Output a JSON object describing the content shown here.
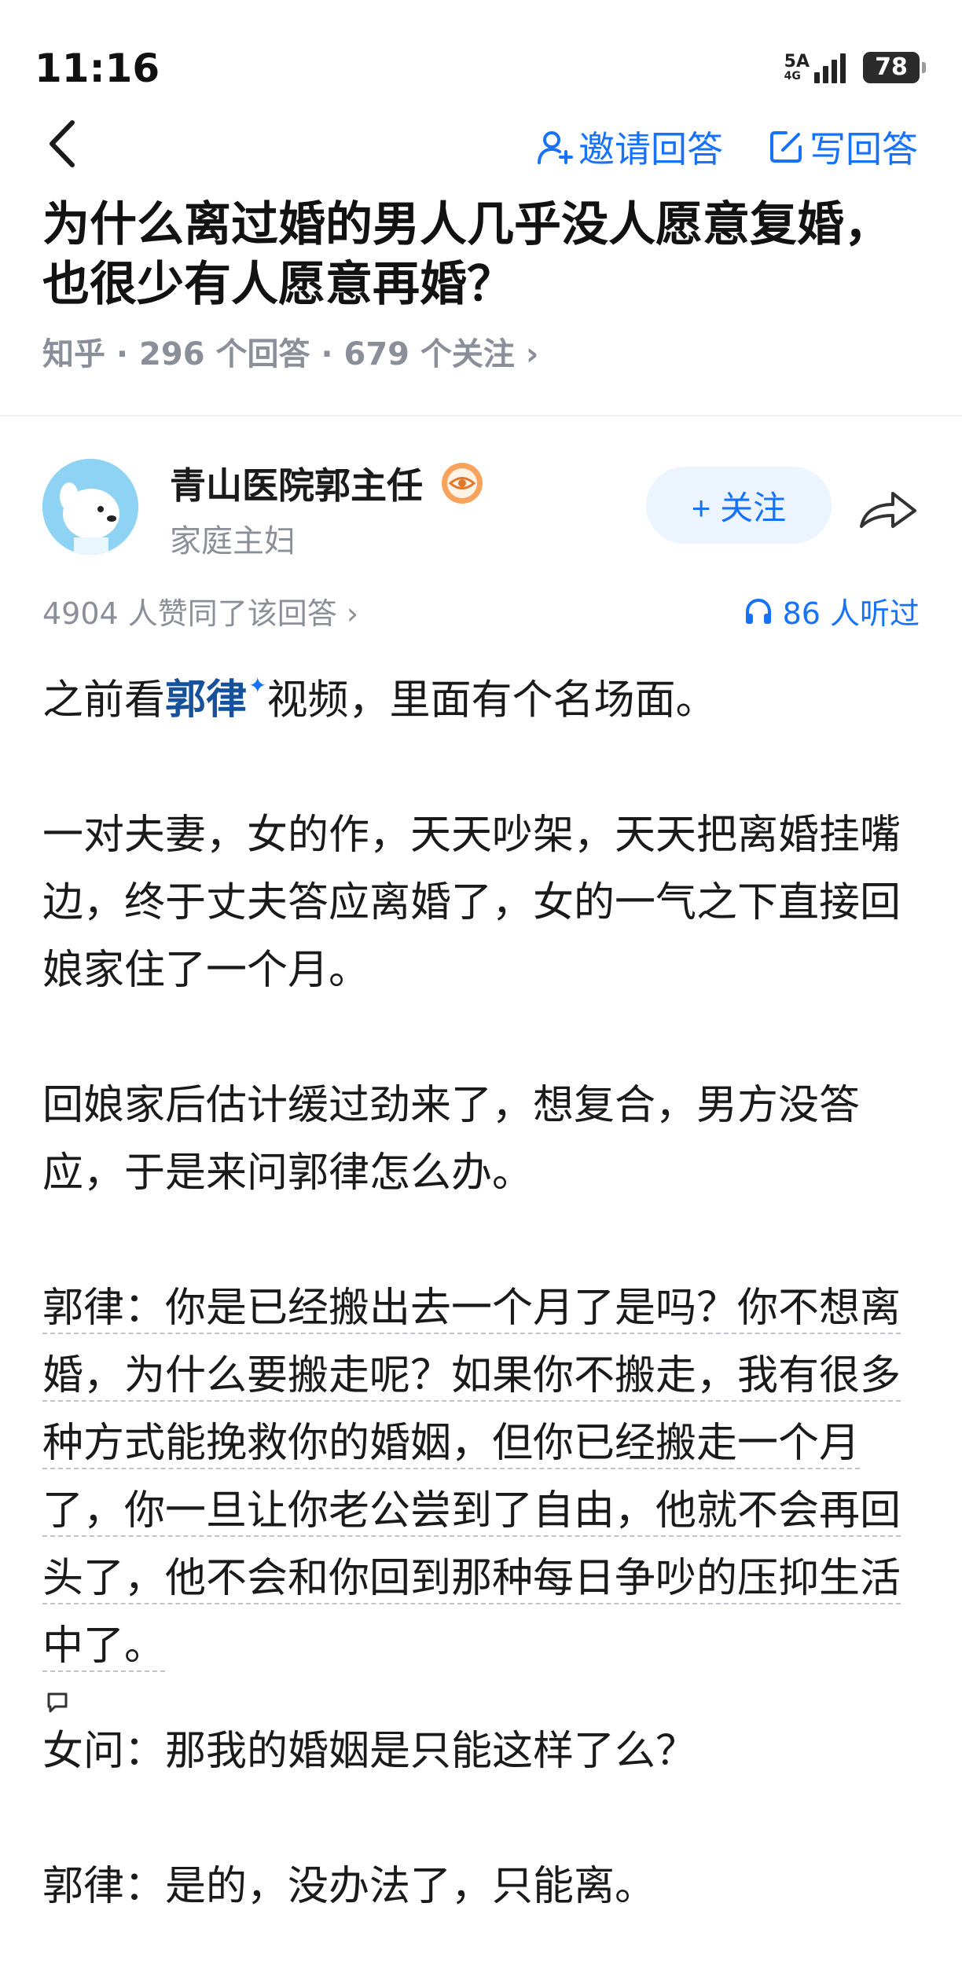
{
  "status_bar": {
    "time": "11:16",
    "network_top": "5A",
    "network_bottom": "4G",
    "battery": "78"
  },
  "nav": {
    "invite_label": "邀请回答",
    "write_label": "写回答"
  },
  "question": {
    "title": "为什么离过婚的男人几乎没人愿意复婚，也很少有人愿意再婚？",
    "meta": "知乎 · 296 个回答 · 679 个关注 ›"
  },
  "author": {
    "name": "青山医院郭主任",
    "description": "家庭主妇",
    "follow_label": "+ 关注"
  },
  "answer": {
    "likes_text": "4904 人赞同了该回答 ›",
    "listen_text": "86 人听过",
    "p1_before": "之前看",
    "p1_link": "郭律",
    "p1_after": "视频，里面有个名场面。",
    "p2": "一对夫妻，女的作，天天吵架，天天把离婚挂嘴边，终于丈夫答应离婚了，女的一气之下直接回娘家住了一个月。",
    "p3": "回娘家后估计缓过劲来了，想复合，男方没答应，于是来问郭律怎么办。",
    "p4": "郭律：你是已经搬出去一个月了是吗？你不想离婚，为什么要搬走呢？如果你不搬走，我有很多种方式能挽救你的婚姻，但你已经搬走一个月了，你一旦让你老公尝到了自由，他就不会再回头了，他不会和你回到那种每日争吵的压抑生活中了。",
    "p5": "女问：那我的婚姻是只能这样了么？",
    "p6": "郭律：是的，没办法了，只能离。"
  },
  "colors": {
    "accent": "#1772f6",
    "secondary_text": "#8a8f99",
    "follow_bg": "#ebf4ff"
  },
  "icons": {
    "back": "chevron-left-icon",
    "invite": "person-plus-icon",
    "write": "edit-icon",
    "badge": "eye-badge-icon",
    "share": "share-arrow-icon",
    "listen": "headphones-icon",
    "comment": "comment-bubble-icon"
  }
}
